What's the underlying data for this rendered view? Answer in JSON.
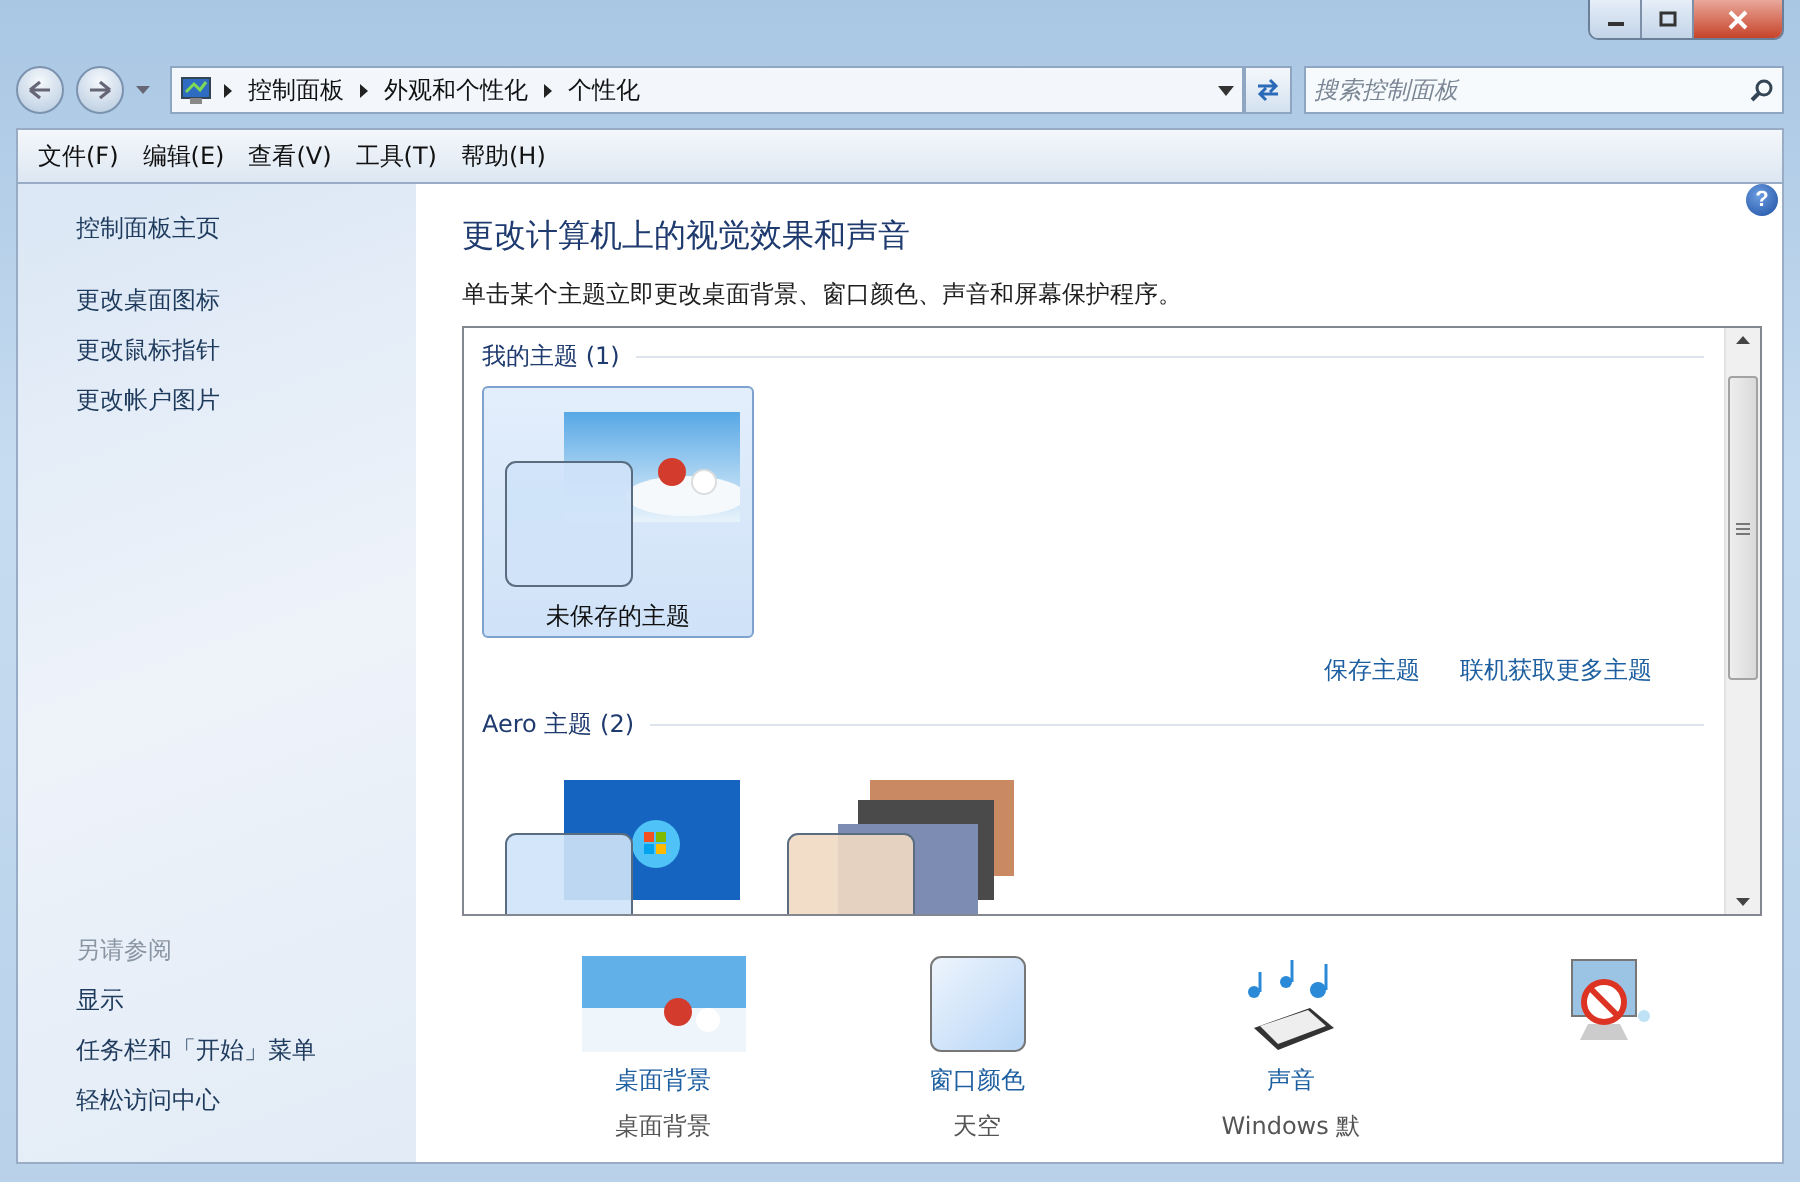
{
  "address_bar": {
    "breadcrumbs": [
      "控制面板",
      "外观和个性化",
      "个性化"
    ]
  },
  "search": {
    "placeholder": "搜索控制面板"
  },
  "menu": [
    "文件(F)",
    "编辑(E)",
    "查看(V)",
    "工具(T)",
    "帮助(H)"
  ],
  "sidebar": {
    "links": [
      "控制面板主页",
      "更改桌面图标",
      "更改鼠标指针",
      "更改帐户图片"
    ],
    "see_also_title": "另请参阅",
    "see_also": [
      "显示",
      "任务栏和「开始」菜单",
      "轻松访问中心"
    ]
  },
  "help": "?",
  "main": {
    "title": "更改计算机上的视觉效果和声音",
    "description": "单击某个主题立即更改桌面背景、窗口颜色、声音和屏幕保护程序。",
    "theme_groups": [
      {
        "heading": "我的主题 (1)",
        "themes": [
          {
            "kind": "photo",
            "label": "未保存的主题",
            "selected": true
          }
        ],
        "links": [
          "保存主题",
          "联机获取更多主题"
        ]
      },
      {
        "heading": "Aero 主题 (2)",
        "themes": [
          {
            "kind": "windows",
            "selected": false
          },
          {
            "kind": "slideshow",
            "selected": false
          }
        ]
      }
    ]
  },
  "settings": [
    {
      "kind": "background",
      "label": "桌面背景",
      "value": "桌面背景"
    },
    {
      "kind": "color",
      "label": "窗口颜色",
      "value": "天空"
    },
    {
      "kind": "sound",
      "label": "声音",
      "value": "Windows 默"
    },
    {
      "kind": "screensaver"
    }
  ]
}
